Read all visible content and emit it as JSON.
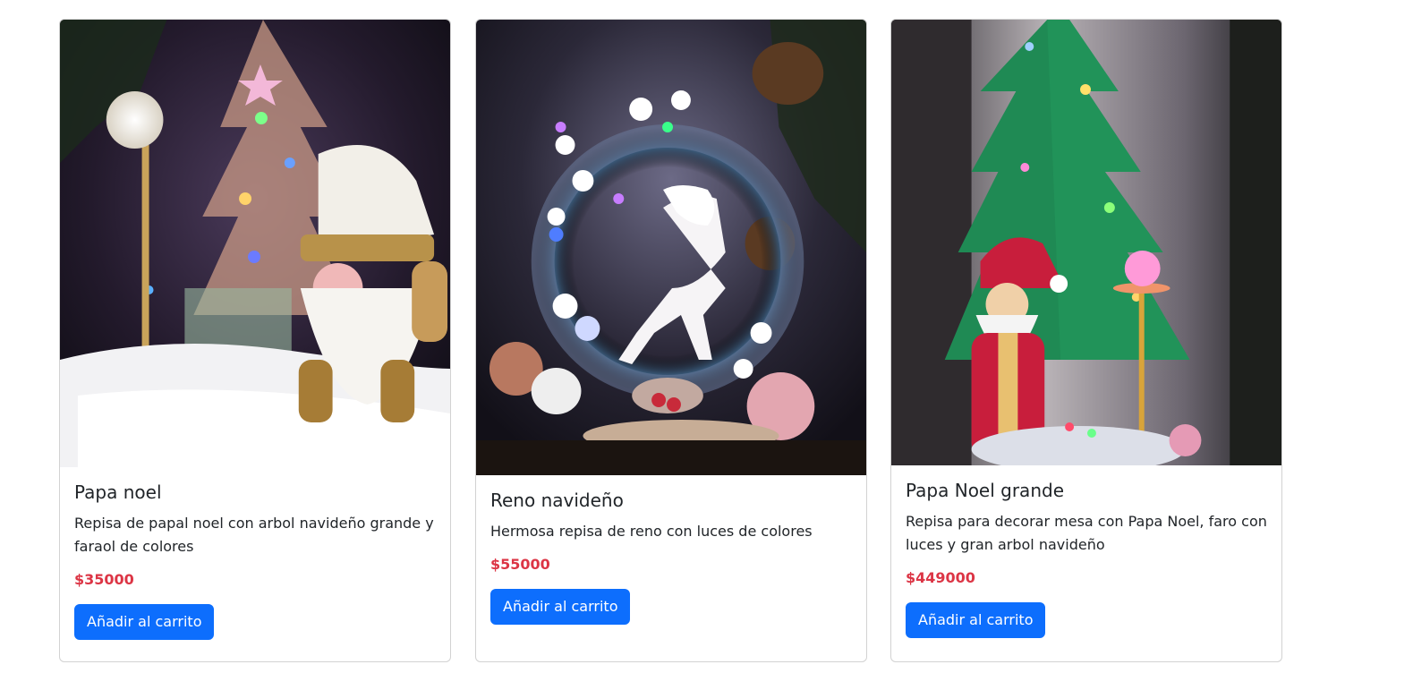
{
  "theme": {
    "accent": "#0d6efd",
    "price_color": "#dc3545",
    "border_color": "#d9d9d9"
  },
  "products": [
    {
      "image_alt": "Papa noel",
      "title": "Papa noel",
      "description": "Repisa de papal noel con arbol navideño grande y faraol de colores",
      "price": "$35000",
      "button_label": "Añadir al carrito"
    },
    {
      "image_alt": "Reno navideño",
      "title": "Reno navideño",
      "description": "Hermosa repisa de reno con luces de colores",
      "price": "$55000",
      "button_label": "Añadir al carrito"
    },
    {
      "image_alt": "Papa Noel grande",
      "title": "Papa Noel grande",
      "description": "Repisa para decorar mesa con Papa Noel, faro con luces y gran arbol navideño",
      "price": "$449000",
      "button_label": "Añadir al carrito"
    }
  ]
}
